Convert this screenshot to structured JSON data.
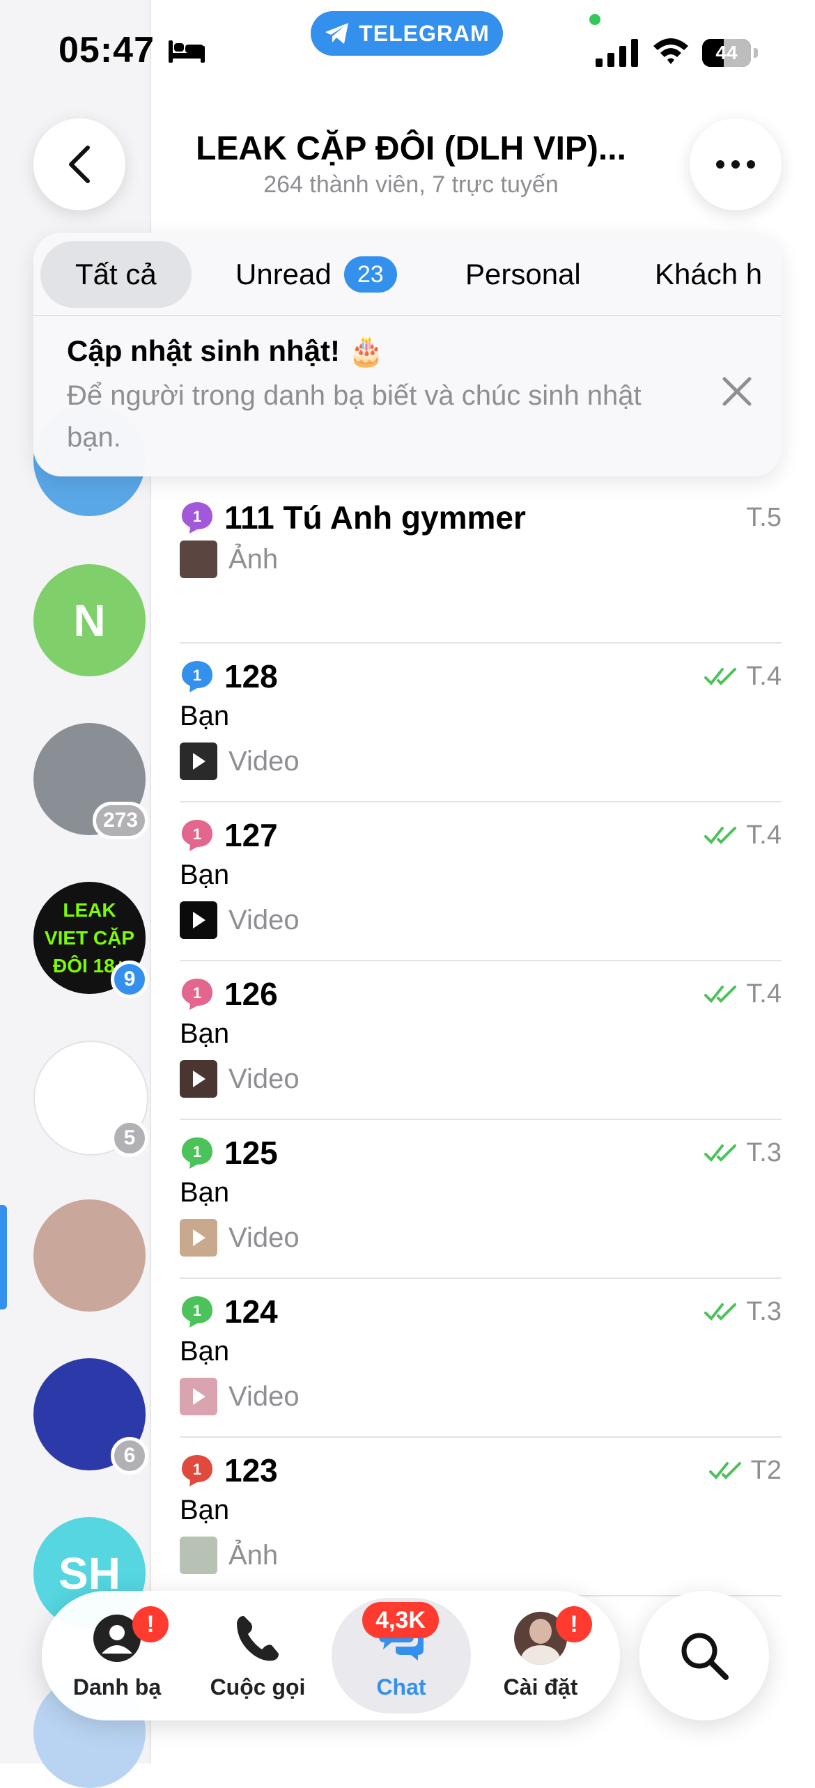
{
  "status_bar": {
    "time": "05:47",
    "app_pill": "TELEGRAM",
    "battery": "44",
    "battery_level": 0.44
  },
  "header": {
    "title": "LEAK CẶP ĐÔI (DLH VIP)...",
    "subtitle": "264 thành viên, 7 trực tuyến"
  },
  "folders": [
    {
      "label": "Tất cả",
      "active": true
    },
    {
      "label": "Unread",
      "count": "23"
    },
    {
      "label": "Personal"
    },
    {
      "label": "Khách h"
    }
  ],
  "birthday_card": {
    "title": "Cập nhật sinh nhật! 🎂",
    "text": "Để người trong danh bạ biết và chúc sinh nhật bạn."
  },
  "rail": [
    {
      "initial": "",
      "color": "#5aa7e8"
    },
    {
      "initial": "N",
      "color": "#7fcf6a"
    },
    {
      "initial": "",
      "color": "#8a8f96",
      "badge": "273",
      "badge_color": "#b0b0b5"
    },
    {
      "initial": "LEAK VIET CẶP ĐÔI 18+",
      "color": "#111111",
      "badge": "9",
      "badge_color": "#3390ec"
    },
    {
      "initial": "",
      "color": "#ffffff",
      "badge": "5",
      "badge_color": "#b0b0b5"
    },
    {
      "initial": "",
      "color": "#c9a79a"
    },
    {
      "initial": "",
      "color": "#2b3aa8",
      "badge": "6",
      "badge_color": "#b0b0b5"
    },
    {
      "initial": "SH",
      "color": "#55d6e0"
    },
    {
      "initial": "",
      "color": "#b9d4f3"
    }
  ],
  "chats": [
    {
      "name": "111 Tú Anh gymmer",
      "icon_color": "#a259d9",
      "date": "T.5",
      "read": false,
      "sender": "",
      "media": "Ảnh",
      "thumb_color": "#5a4540",
      "is_video": false
    },
    {
      "name": "128",
      "icon_color": "#3390ec",
      "date": "T.4",
      "read": true,
      "sender": "Bạn",
      "media": "Video",
      "thumb_color": "#2a2a2a",
      "is_video": true
    },
    {
      "name": "127",
      "icon_color": "#e2668d",
      "date": "T.4",
      "read": true,
      "sender": "Bạn",
      "media": "Video",
      "thumb_color": "#0b0b0b",
      "is_video": true
    },
    {
      "name": "126",
      "icon_color": "#e2668d",
      "date": "T.4",
      "read": true,
      "sender": "Bạn",
      "media": "Video",
      "thumb_color": "#4a3530",
      "is_video": true
    },
    {
      "name": "125",
      "icon_color": "#4cc25a",
      "date": "T.3",
      "read": true,
      "sender": "Bạn",
      "media": "Video",
      "thumb_color": "#c8a98e",
      "is_video": true
    },
    {
      "name": "124",
      "icon_color": "#4cc25a",
      "date": "T.3",
      "read": true,
      "sender": "Bạn",
      "media": "Video",
      "thumb_color": "#d9a3b0",
      "is_video": true
    },
    {
      "name": "123",
      "icon_color": "#e04a3c",
      "date": "T2",
      "read": true,
      "sender": "Bạn",
      "media": "Ảnh",
      "thumb_color": "#b7c2b5",
      "is_video": false
    }
  ],
  "tabbar": {
    "contacts": {
      "label": "Danh bạ",
      "badge": "!"
    },
    "calls": {
      "label": "Cuộc gọi"
    },
    "chats": {
      "label": "Chat",
      "badge": "4,3K"
    },
    "settings": {
      "label": "Cài đặt",
      "badge": "!"
    }
  },
  "colors": {
    "accent": "#3390ec",
    "read_check": "#4cc25a",
    "badge_red": "#ff3b30",
    "secondary_text": "#8e8e93"
  }
}
